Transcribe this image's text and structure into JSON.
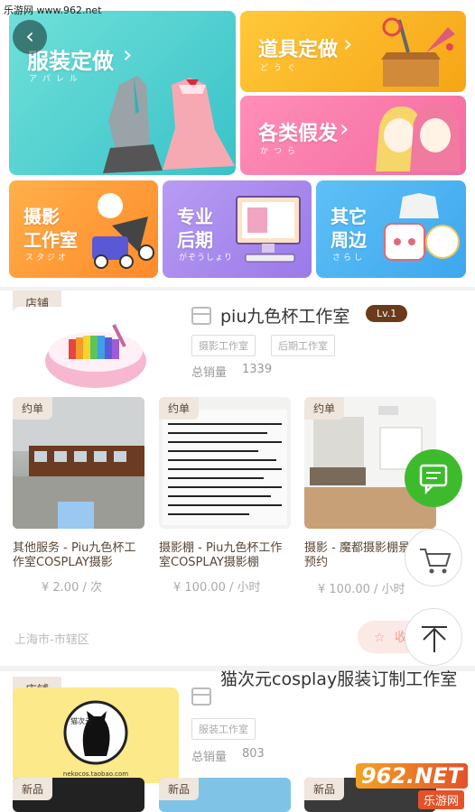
{
  "watermark_top": "乐游网 www.962.net",
  "categories": [
    {
      "title": "服装定做",
      "kana": "アパレル"
    },
    {
      "title": "道具定做",
      "kana": "どうぐ"
    },
    {
      "title": "各类假发",
      "kana": "かつら"
    },
    {
      "title": "摄影工作室",
      "title_l1": "摄影",
      "title_l2": "工作室",
      "kana": "スタジオ"
    },
    {
      "title": "专业后期",
      "title_l1": "专业",
      "title_l2": "后期",
      "kana": "がぞうしょり"
    },
    {
      "title": "其它周边",
      "title_l1": "其它",
      "title_l2": "周边",
      "kana": "さらし"
    }
  ],
  "colors": {
    "accent_brown": "#6b3a1a",
    "tag_bg": "#efe6dd",
    "green_fab": "#3dbb2d"
  },
  "shops": [
    {
      "tag": "店铺",
      "name": "piu九色杯工作室",
      "level": "Lv.1",
      "chips": [
        "摄影工作室",
        "后期工作室"
      ],
      "sales_label": "总销量",
      "sales": "1339",
      "location": "上海市-市辖区",
      "items": [
        {
          "tag": "约单",
          "title": "其他服务 - Piu九色杯工作室COSPLAY摄影",
          "price": "¥ 2.00 / 次"
        },
        {
          "tag": "约单",
          "title": "摄影棚 - Piu九色杯工作室COSPLAY摄影棚",
          "price": "¥ 100.00 / 小时"
        },
        {
          "tag": "约单",
          "title": "摄影 - 魔都摄影棚景棚预约",
          "price": "¥ 100.00 / 小时"
        }
      ],
      "fav_label": "收"
    },
    {
      "tag": "店铺",
      "name": "猫次元cosplay服装订制工作室",
      "chips": [
        "服装工作室"
      ],
      "sales_label": "总销量",
      "sales": "803",
      "logo_text": "猫次元",
      "items": [
        {
          "tag": "新品"
        },
        {
          "tag": "新品"
        },
        {
          "tag": "新品"
        }
      ]
    }
  ],
  "icons": {
    "back": "back-arrow-icon",
    "chat": "chat-icon",
    "cart": "cart-icon",
    "top": "scroll-top-icon",
    "store": "store-icon",
    "star": "star-icon"
  },
  "watermark_br": "962.NET",
  "watermark_br_sub": "乐游网"
}
